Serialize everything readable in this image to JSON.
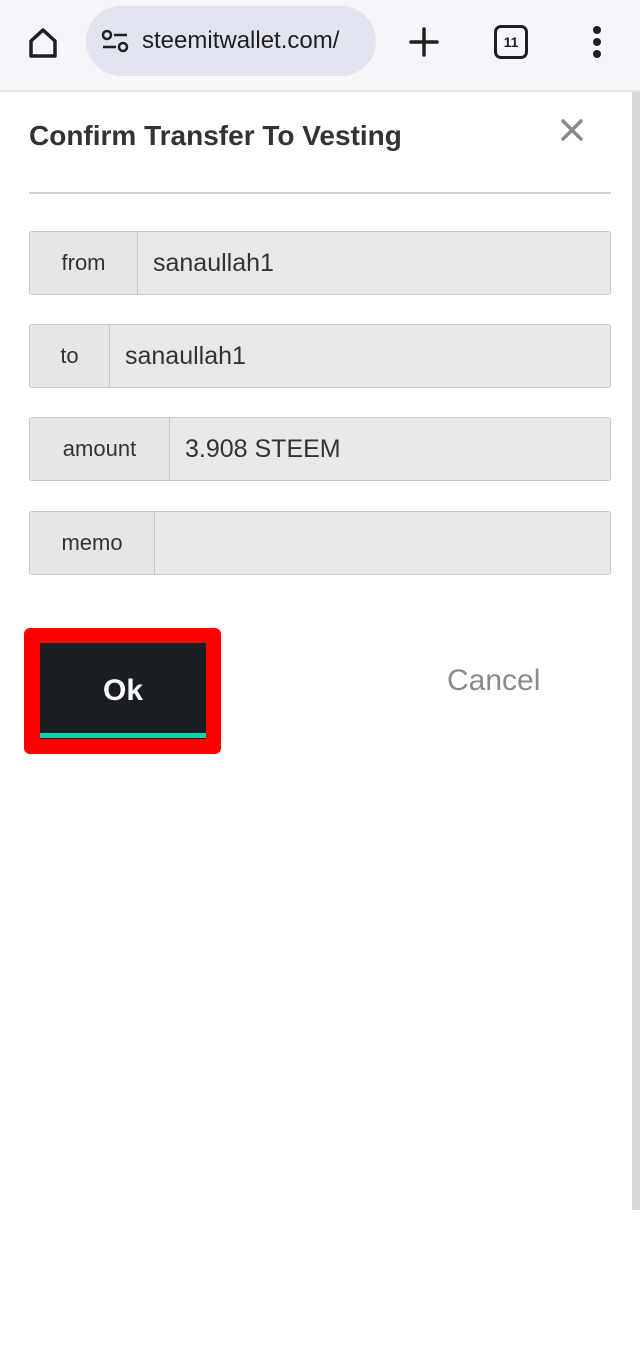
{
  "browser": {
    "url": "steemitwallet.com/",
    "tab_count": "11",
    "icons": {
      "home": "home-icon",
      "site_settings": "tune-icon",
      "new_tab": "plus-icon",
      "tabs": "tab-switcher-icon",
      "menu": "more-vert-icon"
    }
  },
  "modal": {
    "title": "Confirm Transfer To Vesting",
    "close_icon": "close-icon",
    "fields": [
      {
        "label": "from",
        "value": "sanaullah1"
      },
      {
        "label": "to",
        "value": "sanaullah1"
      },
      {
        "label": "amount",
        "value": "3.908 STEEM"
      },
      {
        "label": "memo",
        "value": ""
      }
    ],
    "ok_label": "Ok",
    "cancel_label": "Cancel"
  },
  "colors": {
    "ok_button_bg": "#1a1e22",
    "ok_accent": "#06d6a9",
    "highlight": "#ff0000",
    "field_bg": "#e8e8e8"
  }
}
